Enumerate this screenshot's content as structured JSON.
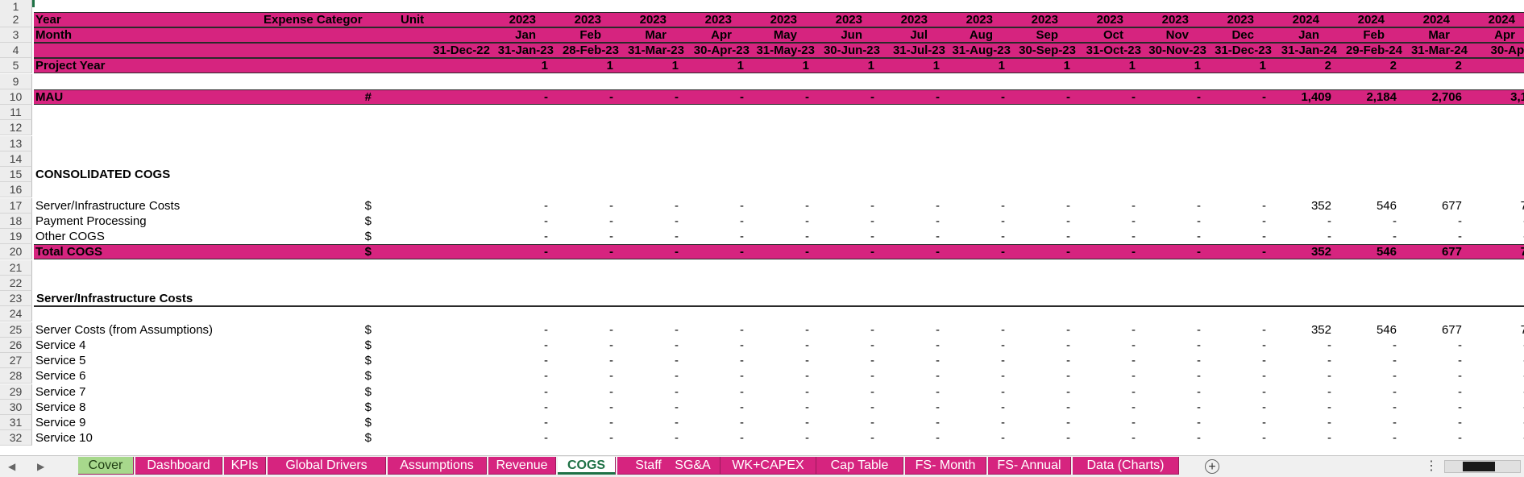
{
  "row_numbers": [
    "1",
    "2",
    "3",
    "4",
    "5",
    "9",
    "10",
    "11",
    "12",
    "13",
    "14",
    "15",
    "16",
    "17",
    "18",
    "19",
    "20",
    "21",
    "22",
    "23",
    "24",
    "25",
    "26",
    "27",
    "28",
    "29",
    "30",
    "31",
    "32"
  ],
  "header": {
    "year_label": "Year",
    "month_label": "Month",
    "expense_category": "Expense Categor",
    "unit": "Unit",
    "project_year_label": "Project Year",
    "first_date": "31-Dec-22",
    "years": [
      "2023",
      "2023",
      "2023",
      "2023",
      "2023",
      "2023",
      "2023",
      "2023",
      "2023",
      "2023",
      "2023",
      "2023",
      "2024",
      "2024",
      "2024",
      "2024"
    ],
    "months": [
      "Jan",
      "Feb",
      "Mar",
      "Apr",
      "May",
      "Jun",
      "Jul",
      "Aug",
      "Sep",
      "Oct",
      "Nov",
      "Dec",
      "Jan",
      "Feb",
      "Mar",
      "Apr"
    ],
    "dates": [
      "31-Jan-23",
      "28-Feb-23",
      "31-Mar-23",
      "30-Apr-23",
      "31-May-23",
      "30-Jun-23",
      "31-Jul-23",
      "31-Aug-23",
      "30-Sep-23",
      "31-Oct-23",
      "30-Nov-23",
      "31-Dec-23",
      "31-Jan-24",
      "29-Feb-24",
      "31-Mar-24",
      "30-Apr-"
    ],
    "project_years": [
      "1",
      "1",
      "1",
      "1",
      "1",
      "1",
      "1",
      "1",
      "1",
      "1",
      "1",
      "1",
      "2",
      "2",
      "2",
      ""
    ]
  },
  "mau": {
    "label": "MAU",
    "unit": "#",
    "values": [
      "-",
      "-",
      "-",
      "-",
      "-",
      "-",
      "-",
      "-",
      "-",
      "-",
      "-",
      "-",
      "1,409",
      "2,184",
      "2,706",
      "3,1"
    ]
  },
  "consolidated": {
    "title": "CONSOLIDATED COGS",
    "rows": [
      {
        "label": "Server/Infrastructure Costs",
        "unit": "$",
        "values": [
          "-",
          "-",
          "-",
          "-",
          "-",
          "-",
          "-",
          "-",
          "-",
          "-",
          "-",
          "-",
          "352",
          "546",
          "677",
          "7"
        ]
      },
      {
        "label": "Payment Processing",
        "unit": "$",
        "values": [
          "-",
          "-",
          "-",
          "-",
          "-",
          "-",
          "-",
          "-",
          "-",
          "-",
          "-",
          "-",
          "-",
          "-",
          "-",
          "-"
        ]
      },
      {
        "label": "Other COGS",
        "unit": "$",
        "values": [
          "-",
          "-",
          "-",
          "-",
          "-",
          "-",
          "-",
          "-",
          "-",
          "-",
          "-",
          "-",
          "-",
          "-",
          "-",
          "-"
        ]
      }
    ],
    "total": {
      "label": "Total COGS",
      "unit": "$",
      "values": [
        "-",
        "-",
        "-",
        "-",
        "-",
        "-",
        "-",
        "-",
        "-",
        "-",
        "-",
        "-",
        "352",
        "546",
        "677",
        "7"
      ]
    }
  },
  "server_section": {
    "title": "Server/Infrastructure Costs",
    "rows": [
      {
        "label": "Server Costs (from Assumptions)",
        "unit": "$",
        "values": [
          "-",
          "-",
          "-",
          "-",
          "-",
          "-",
          "-",
          "-",
          "-",
          "-",
          "-",
          "-",
          "352",
          "546",
          "677",
          "7"
        ]
      },
      {
        "label": "Service 4",
        "unit": "$",
        "values": [
          "-",
          "-",
          "-",
          "-",
          "-",
          "-",
          "-",
          "-",
          "-",
          "-",
          "-",
          "-",
          "-",
          "-",
          "-",
          "-"
        ]
      },
      {
        "label": "Service 5",
        "unit": "$",
        "values": [
          "-",
          "-",
          "-",
          "-",
          "-",
          "-",
          "-",
          "-",
          "-",
          "-",
          "-",
          "-",
          "-",
          "-",
          "-",
          "-"
        ]
      },
      {
        "label": "Service 6",
        "unit": "$",
        "values": [
          "-",
          "-",
          "-",
          "-",
          "-",
          "-",
          "-",
          "-",
          "-",
          "-",
          "-",
          "-",
          "-",
          "-",
          "-",
          "-"
        ]
      },
      {
        "label": "Service 7",
        "unit": "$",
        "values": [
          "-",
          "-",
          "-",
          "-",
          "-",
          "-",
          "-",
          "-",
          "-",
          "-",
          "-",
          "-",
          "-",
          "-",
          "-",
          "-"
        ]
      },
      {
        "label": "Service 8",
        "unit": "$",
        "values": [
          "-",
          "-",
          "-",
          "-",
          "-",
          "-",
          "-",
          "-",
          "-",
          "-",
          "-",
          "-",
          "-",
          "-",
          "-",
          "-"
        ]
      },
      {
        "label": "Service 9",
        "unit": "$",
        "values": [
          "-",
          "-",
          "-",
          "-",
          "-",
          "-",
          "-",
          "-",
          "-",
          "-",
          "-",
          "-",
          "-",
          "-",
          "-",
          "-"
        ]
      },
      {
        "label": "Service 10",
        "unit": "$",
        "values": [
          "-",
          "-",
          "-",
          "-",
          "-",
          "-",
          "-",
          "-",
          "-",
          "-",
          "-",
          "-",
          "-",
          "-",
          "-",
          "-"
        ]
      }
    ]
  },
  "tabs": {
    "nav_prev": "◀",
    "nav_next": "▶",
    "items": [
      "Cover",
      "Dashboard",
      "KPIs",
      "Global Drivers",
      "Assumptions",
      "Revenue",
      "COGS",
      "Staff",
      "SG&A",
      "WK+CAPEX",
      "Cap Table",
      "FS- Month",
      "FS- Annual",
      "Data (Charts)"
    ],
    "active": "COGS",
    "add": "+",
    "more": "⋮"
  },
  "colors": {
    "band": "#d6247f",
    "active_tab_text": "#1e7145",
    "cover_tab": "#a7d88c"
  }
}
